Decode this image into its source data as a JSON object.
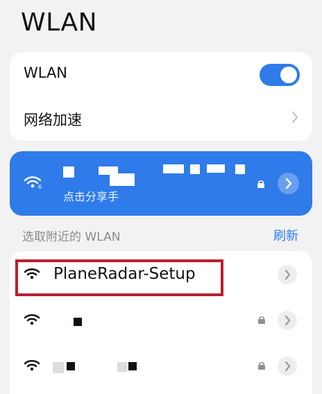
{
  "page": {
    "title": "WLAN"
  },
  "settings": {
    "wlan_label": "WLAN",
    "wlan_enabled": true,
    "network_acceleration_label": "网络加速"
  },
  "connected_network": {
    "status_text": "点击分享手",
    "wifi_icon": "wifi-6-icon",
    "secured_icon": "lock-icon",
    "arrow_icon": "chevron-right-icon"
  },
  "available_networks": {
    "section_label": "选取附近的 WLAN",
    "refresh_label": "刷新",
    "items": [
      {
        "name": "PlaneRadar-Setup",
        "secured": false
      },
      {
        "name": "",
        "secured": true
      },
      {
        "name": "",
        "secured": true
      }
    ]
  },
  "colors": {
    "accent": "#2f7bea",
    "highlight": "#b81f2e"
  }
}
